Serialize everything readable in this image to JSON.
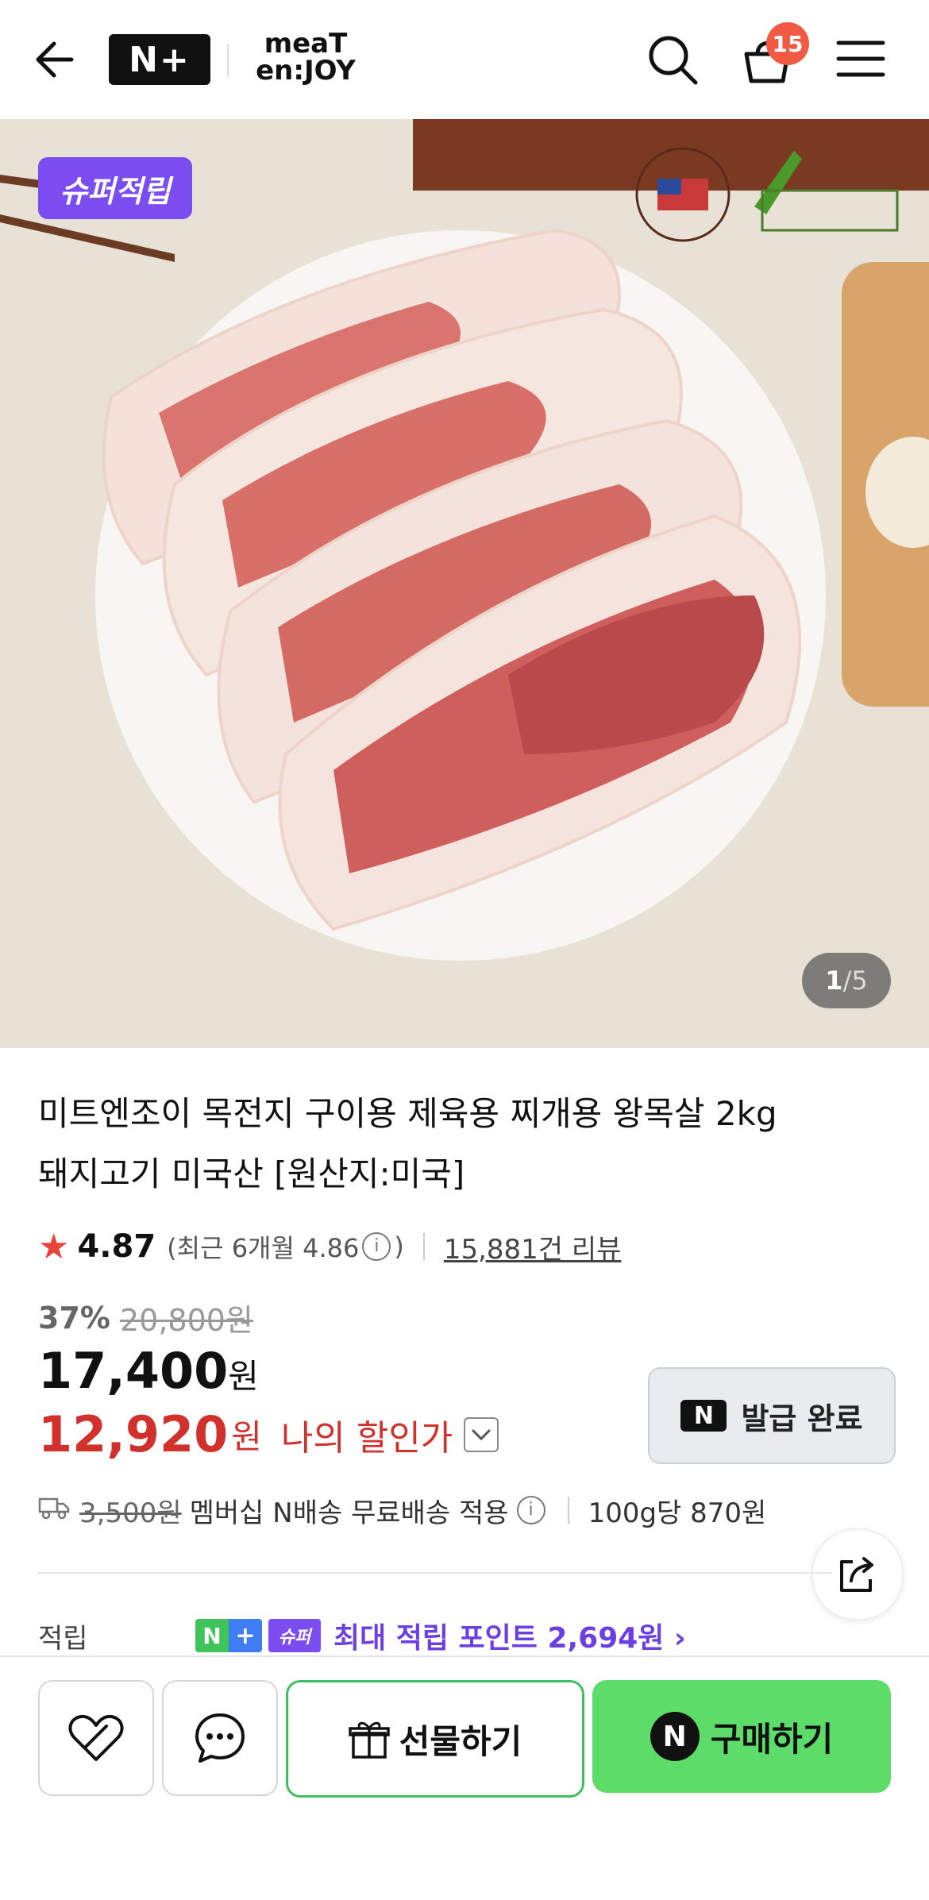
{
  "header": {
    "logo_np": "N+",
    "brand_line1": "meaT",
    "brand_line2": "en:JOY",
    "cart_count": "15"
  },
  "hero": {
    "badge": "슈퍼적립",
    "counter_current": "1",
    "counter_total": "/5"
  },
  "product": {
    "title_line1": "미트엔조이 목전지 구이용 제육용 찌개용 왕목살 2kg",
    "title_line2": "돼지고기 미국산 [원산지:미국]"
  },
  "rating": {
    "star": "★",
    "score": "4.87",
    "recent_prefix": "(최근 6개월 4.86",
    "recent_suffix": ")",
    "reviews": "15,881건 리뷰"
  },
  "price": {
    "discount_pct": "37%",
    "original": "20,800원",
    "sale": "17,400",
    "won": "원",
    "my_price": "12,920",
    "my_label": "나의 할인가"
  },
  "coupon": {
    "logo": "N",
    "label": "발급 완료"
  },
  "shipping": {
    "original_fee": "3,500원",
    "text": "멤버십 N배송 무료배송 적용",
    "unit_price": "100g당 870원"
  },
  "points": {
    "label": "적립",
    "np_n": "N",
    "np_plus": "+",
    "super": "슈퍼",
    "text": "최대 적립 포인트 2,694원 ›"
  },
  "bottom_bar": {
    "gift_label": "선물하기",
    "buy_logo": "N",
    "buy_label": "구매하기"
  },
  "colors": {
    "accent_red": "#d0312d",
    "super_purple": "#7b4cf0",
    "buy_green": "#5ddc6a",
    "badge_red": "#f15a42"
  }
}
